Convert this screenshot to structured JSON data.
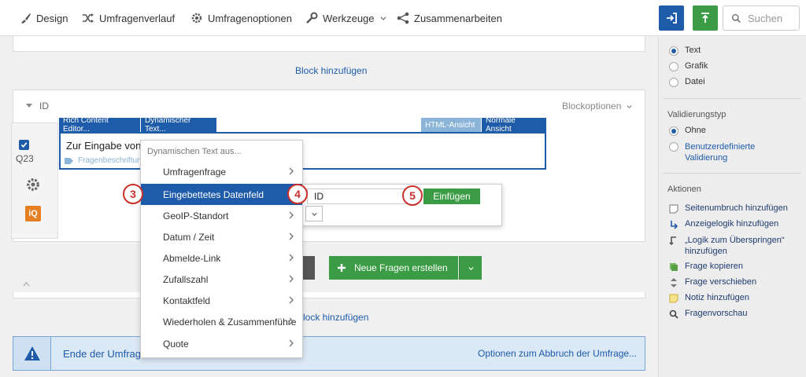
{
  "toolbar": {
    "design": "Design",
    "history": "Umfragenverlauf",
    "options": "Umfragenoptionen",
    "tools": "Werkzeuge",
    "collaborate": "Zusammenarbeiten",
    "search_placeholder": "Suchen"
  },
  "main": {
    "add_block_top": "Block hinzufügen",
    "block_name": "ID",
    "block_options": "Blockoptionen",
    "question_number": "Q23",
    "tabs": {
      "rich_editor": "Rich Content Editor...",
      "dynamic_text": "Dynamischer Text...",
      "html_view": "HTML-Ansicht",
      "normal_view": "Normale Ansicht"
    },
    "question_text": "Zur Eingabe von",
    "question_label": "Fragenbeschriftung",
    "new_questions": "Neue Fragen erstellen",
    "add_block_bottom": "lock hinzufügen",
    "end_of_survey": "Ende der Umfrage",
    "end_options": "Optionen zum Abbruch der Umfrage...",
    "iq_label": "iQ"
  },
  "menu": {
    "header": "Dynamischen Text aus...",
    "items": [
      "Umfragenfrage",
      "Eingebettetes Datenfeld",
      "GeoIP-Standort",
      "Datum / Zeit",
      "Abmelde-Link",
      "Zufallszahl",
      "Kontaktfeld",
      "Wiederholen & Zusammenführe",
      "Quote"
    ]
  },
  "submenu": {
    "field_value": "ID",
    "insert_button": "Einfügen"
  },
  "badges": [
    "3",
    "4",
    "5"
  ],
  "sidebar": {
    "content_type": [
      "Text",
      "Grafik",
      "Datei"
    ],
    "validation_heading": "Validierungstyp",
    "validation_none": "Ohne",
    "validation_custom": "Benutzerdefinierte Validierung",
    "actions_heading": "Aktionen",
    "actions": [
      "Seitenumbruch hinzufügen",
      "Anzeigelogik hinzufügen",
      "„Logik zum Überspringen“ hinzufügen",
      "Frage kopieren",
      "Frage verschieben",
      "Notiz hinzufügen",
      "Fragenvorschau"
    ]
  },
  "colors": {
    "accent_blue": "#1e5ba8",
    "green": "#3b9c45",
    "badge_red": "#c9302c",
    "orange": "#e67e22"
  }
}
